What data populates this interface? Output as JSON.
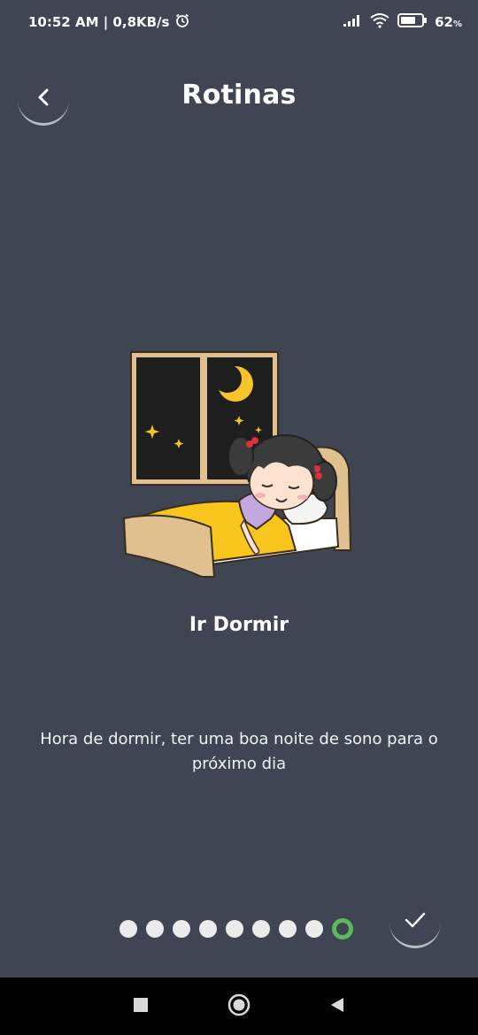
{
  "status_bar": {
    "time_speed": "10:52 AM | 0,8KB/s",
    "battery": "62"
  },
  "header": {
    "title": "Rotinas",
    "back_icon": "chevron-left-icon"
  },
  "routine": {
    "title": "Ir Dormir",
    "description": "Hora de dormir, ter uma boa noite de sono para o próximo dia"
  },
  "pager": {
    "total": 9,
    "active_index": 8
  },
  "colors": {
    "background": "#3f4552",
    "accent": "#5cb85c",
    "nav_bar": "#000000"
  }
}
